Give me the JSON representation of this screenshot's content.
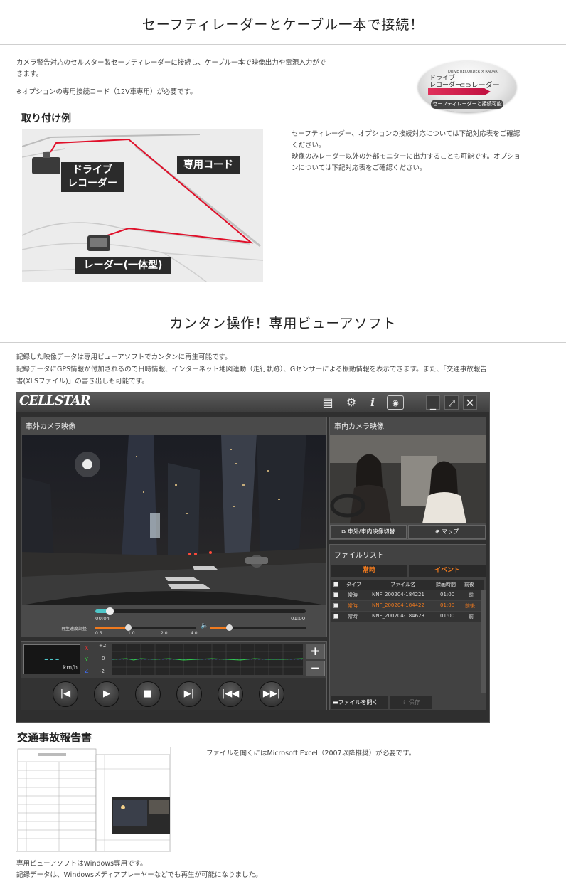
{
  "section1": {
    "title": "セーフティレーダーとケーブル一本で接続！",
    "desc_line1": "カメラ警告対応のセルスター製セーフティレーダーに接続し、ケーブル一本で映像出力や電源入力がで",
    "desc_line2": "きます。",
    "note": "※オプションの専用接続コード（12V車専用）が必要です。",
    "badge": {
      "top_text": "DRIVE RECORDER × RADAR",
      "left_text_1": "ドライブ",
      "left_text_2": "レコーダー",
      "right_text": "レーダー",
      "bottom_text": "セーフティレーダーと接続可能"
    },
    "install_heading": "取り付け例",
    "diagram": {
      "label_recorder_1": "ドライブ",
      "label_recorder_2": "レコーダー",
      "label_cord": "専用コード",
      "label_radar": "レーダー(一体型)"
    },
    "right_line1": "セーフティレーダー、オプションの接続対応については下記対応表をご確認",
    "right_line2": "ください。",
    "right_line3": "映像のみレーダー以外の外部モニターに出力することも可能です。オプショ",
    "right_line4": "ンについては下記対応表をご確認ください。"
  },
  "section2": {
    "title": "カンタン操作！専用ビューアソフト",
    "desc_line1": "記録した映像データは専用ビューアソフトでカンタンに再生可能です。",
    "desc_line2": "記録データにGPS情報が付加されるので日時情報、インターネット地図連動（走行軌跡）、Gセンサーによる振動情報を表示できます。また、「交通事故報告",
    "desc_line3": "書(XLSファイル)」の書き出しも可能です。"
  },
  "viewer": {
    "logo": "CELLSTAR",
    "outside_camera_title": "車外カメラ映像",
    "inside_camera_title": "車内カメラ映像",
    "time_current": "00:04",
    "time_total": "01:00",
    "speed_label": "再生速度調整",
    "speed_ticks": [
      "0.5",
      "1.0",
      "2.0",
      "4.0"
    ],
    "speed_display": "---",
    "speed_unit": "km/h",
    "axis_x": "X",
    "axis_y": "Y",
    "axis_z": "Z",
    "g_plus": "+2",
    "g_zero": "0",
    "g_minus": "-2",
    "switch_button": "車外/車内映像切替",
    "map_button": "マップ",
    "filelist_title": "ファイルリスト",
    "tab_normal": "常時",
    "tab_event": "イベント",
    "columns": [
      "タイプ",
      "ファイル名",
      "録画時間",
      "前後"
    ],
    "rows": [
      {
        "type": "常時",
        "file": "NNF_200204-184221",
        "time": "01:00",
        "pos": "前"
      },
      {
        "type": "常時",
        "file": "NNF_200204-184422",
        "time": "01:00",
        "pos": "前後"
      },
      {
        "type": "常時",
        "file": "NNF_200204-184623",
        "time": "01:00",
        "pos": "前"
      }
    ],
    "open_file_button": "ファイルを開く",
    "save_button": "保存",
    "zoom_in": "+",
    "zoom_out": "−",
    "playback_progress": 0.07,
    "speed_position": 0.33,
    "volume_level": 0.2
  },
  "section3": {
    "heading": "交通事故報告書",
    "excel_note": "ファイルを開くにはMicrosoft Excel（2007以降推奨）が必要です。",
    "footer_line1": "専用ビューアソフトはWindows専用です。",
    "footer_line2": "記録データは、Windowsメディアプレーヤーなどでも再生が可能になりました。"
  },
  "colors": {
    "accent_orange": "#f07a1e",
    "cord_red": "#e0102a",
    "teal_progress": "#4fc6c8"
  }
}
